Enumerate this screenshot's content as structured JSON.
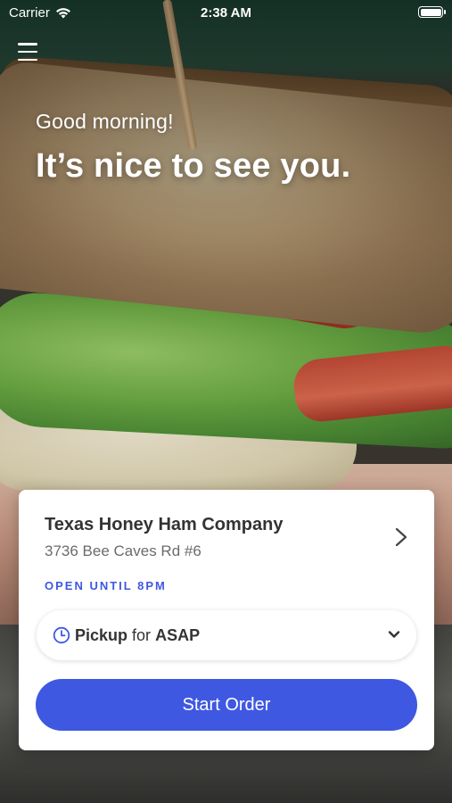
{
  "status_bar": {
    "carrier": "Carrier",
    "time": "2:38 AM"
  },
  "hero": {
    "greeting": "Good morning!",
    "headline": "It’s nice to see you."
  },
  "store": {
    "name": "Texas Honey Ham Company",
    "address": "3736 Bee Caves Rd #6",
    "hours_status": "OPEN UNTIL 8PM"
  },
  "order_mode": {
    "mode": "Pickup",
    "connector": "for",
    "time": "ASAP"
  },
  "actions": {
    "start_order_label": "Start Order"
  },
  "colors": {
    "accent": "#3f58e1",
    "text_dark": "#333333",
    "text_muted": "#6b6b6b"
  },
  "icons": [
    "menu-icon",
    "wifi-icon",
    "battery-icon",
    "chevron-right-icon",
    "clock-icon",
    "chevron-down-icon"
  ]
}
